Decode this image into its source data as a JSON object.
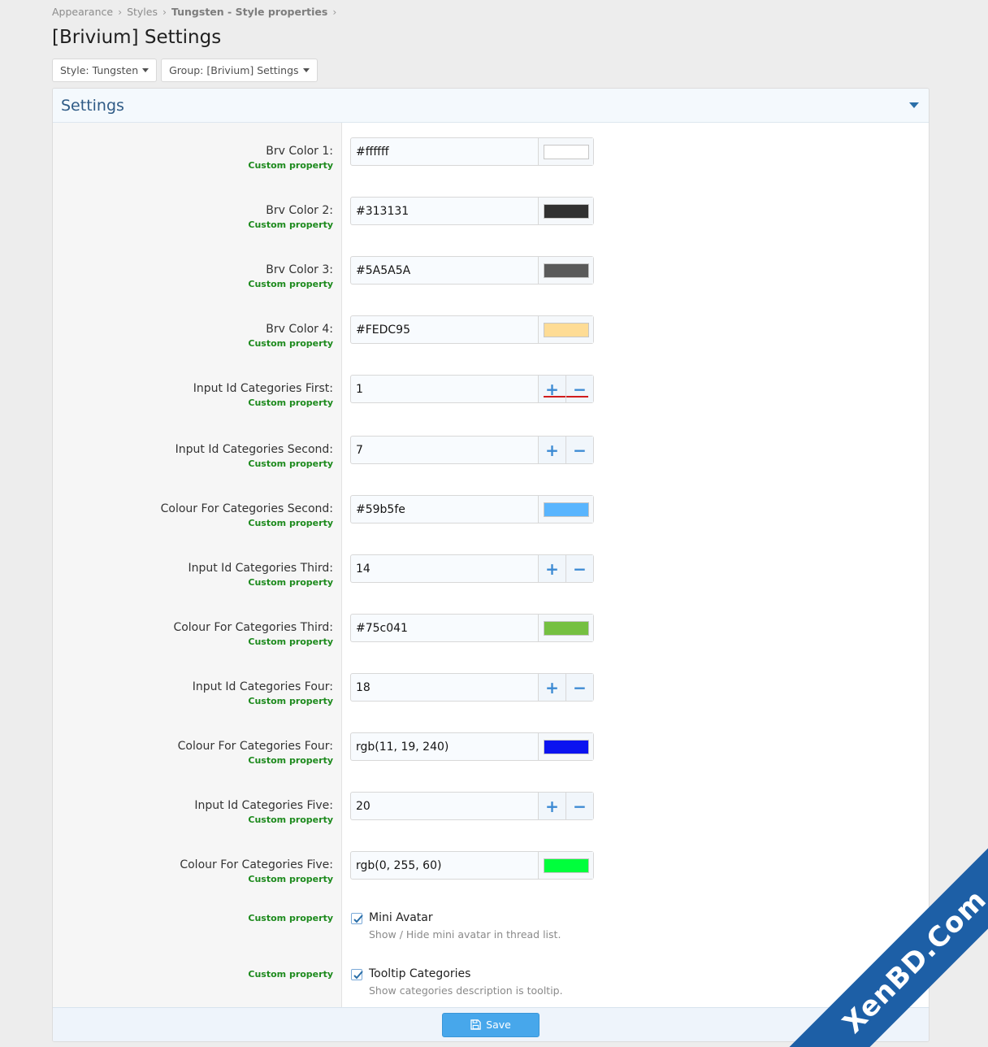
{
  "breadcrumb": {
    "items": [
      "Appearance",
      "Styles",
      "Tungsten",
      "Style properties"
    ],
    "separator": "›"
  },
  "page": {
    "title": "[Brivium] Settings"
  },
  "filters": {
    "style_label": "Style: Tungsten",
    "group_label": "Group: [Brivium] Settings"
  },
  "block": {
    "title": "Settings",
    "hint": "Custom property"
  },
  "rows": [
    {
      "label": "Brv Color 1:",
      "value": "#ffffff",
      "swatch": "#ffffff"
    },
    {
      "label": "Brv Color 2:",
      "value": "#313131",
      "swatch": "#313131"
    },
    {
      "label": "Brv Color 3:",
      "value": "#5A5A5A",
      "swatch": "#5A5A5A"
    },
    {
      "label": "Brv Color 4:",
      "value": "#FEDC95",
      "swatch": "#FEDC95"
    },
    {
      "label": "Input Id Categories First:",
      "value": "1"
    },
    {
      "label": "Input Id Categories Second:",
      "value": "7"
    },
    {
      "label": "Colour For Categories Second:",
      "value": "#59b5fe",
      "swatch": "#59b5fe"
    },
    {
      "label": "Input Id Categories Third:",
      "value": "14"
    },
    {
      "label": "Colour For Categories Third:",
      "value": "#75c041",
      "swatch": "#75c041"
    },
    {
      "label": "Input Id Categories Four:",
      "value": "18"
    },
    {
      "label": "Colour For Categories Four:",
      "value": "rgb(11, 19, 240)",
      "swatch": "rgb(11, 19, 240)"
    },
    {
      "label": "Input Id Categories Five:",
      "value": "20"
    },
    {
      "label": "Colour For Categories Five:",
      "value": "rgb(0, 255, 60)",
      "swatch": "rgb(0, 255, 60)"
    }
  ],
  "checkboxes": [
    {
      "label": "Mini Avatar",
      "description": "Show / Hide mini avatar in thread list.",
      "checked": true
    },
    {
      "label": "Tooltip Categories",
      "description": "Show categories description is tooltip.",
      "checked": true
    }
  ],
  "stepper": {
    "plus": "+",
    "minus": "−"
  },
  "footer": {
    "save_label": "Save"
  },
  "watermark": {
    "text": "XenBD.Com"
  },
  "colors": {
    "accent": "#47a7eb",
    "hint_green": "#1d8a1d",
    "title_blue": "#2f5b86"
  }
}
